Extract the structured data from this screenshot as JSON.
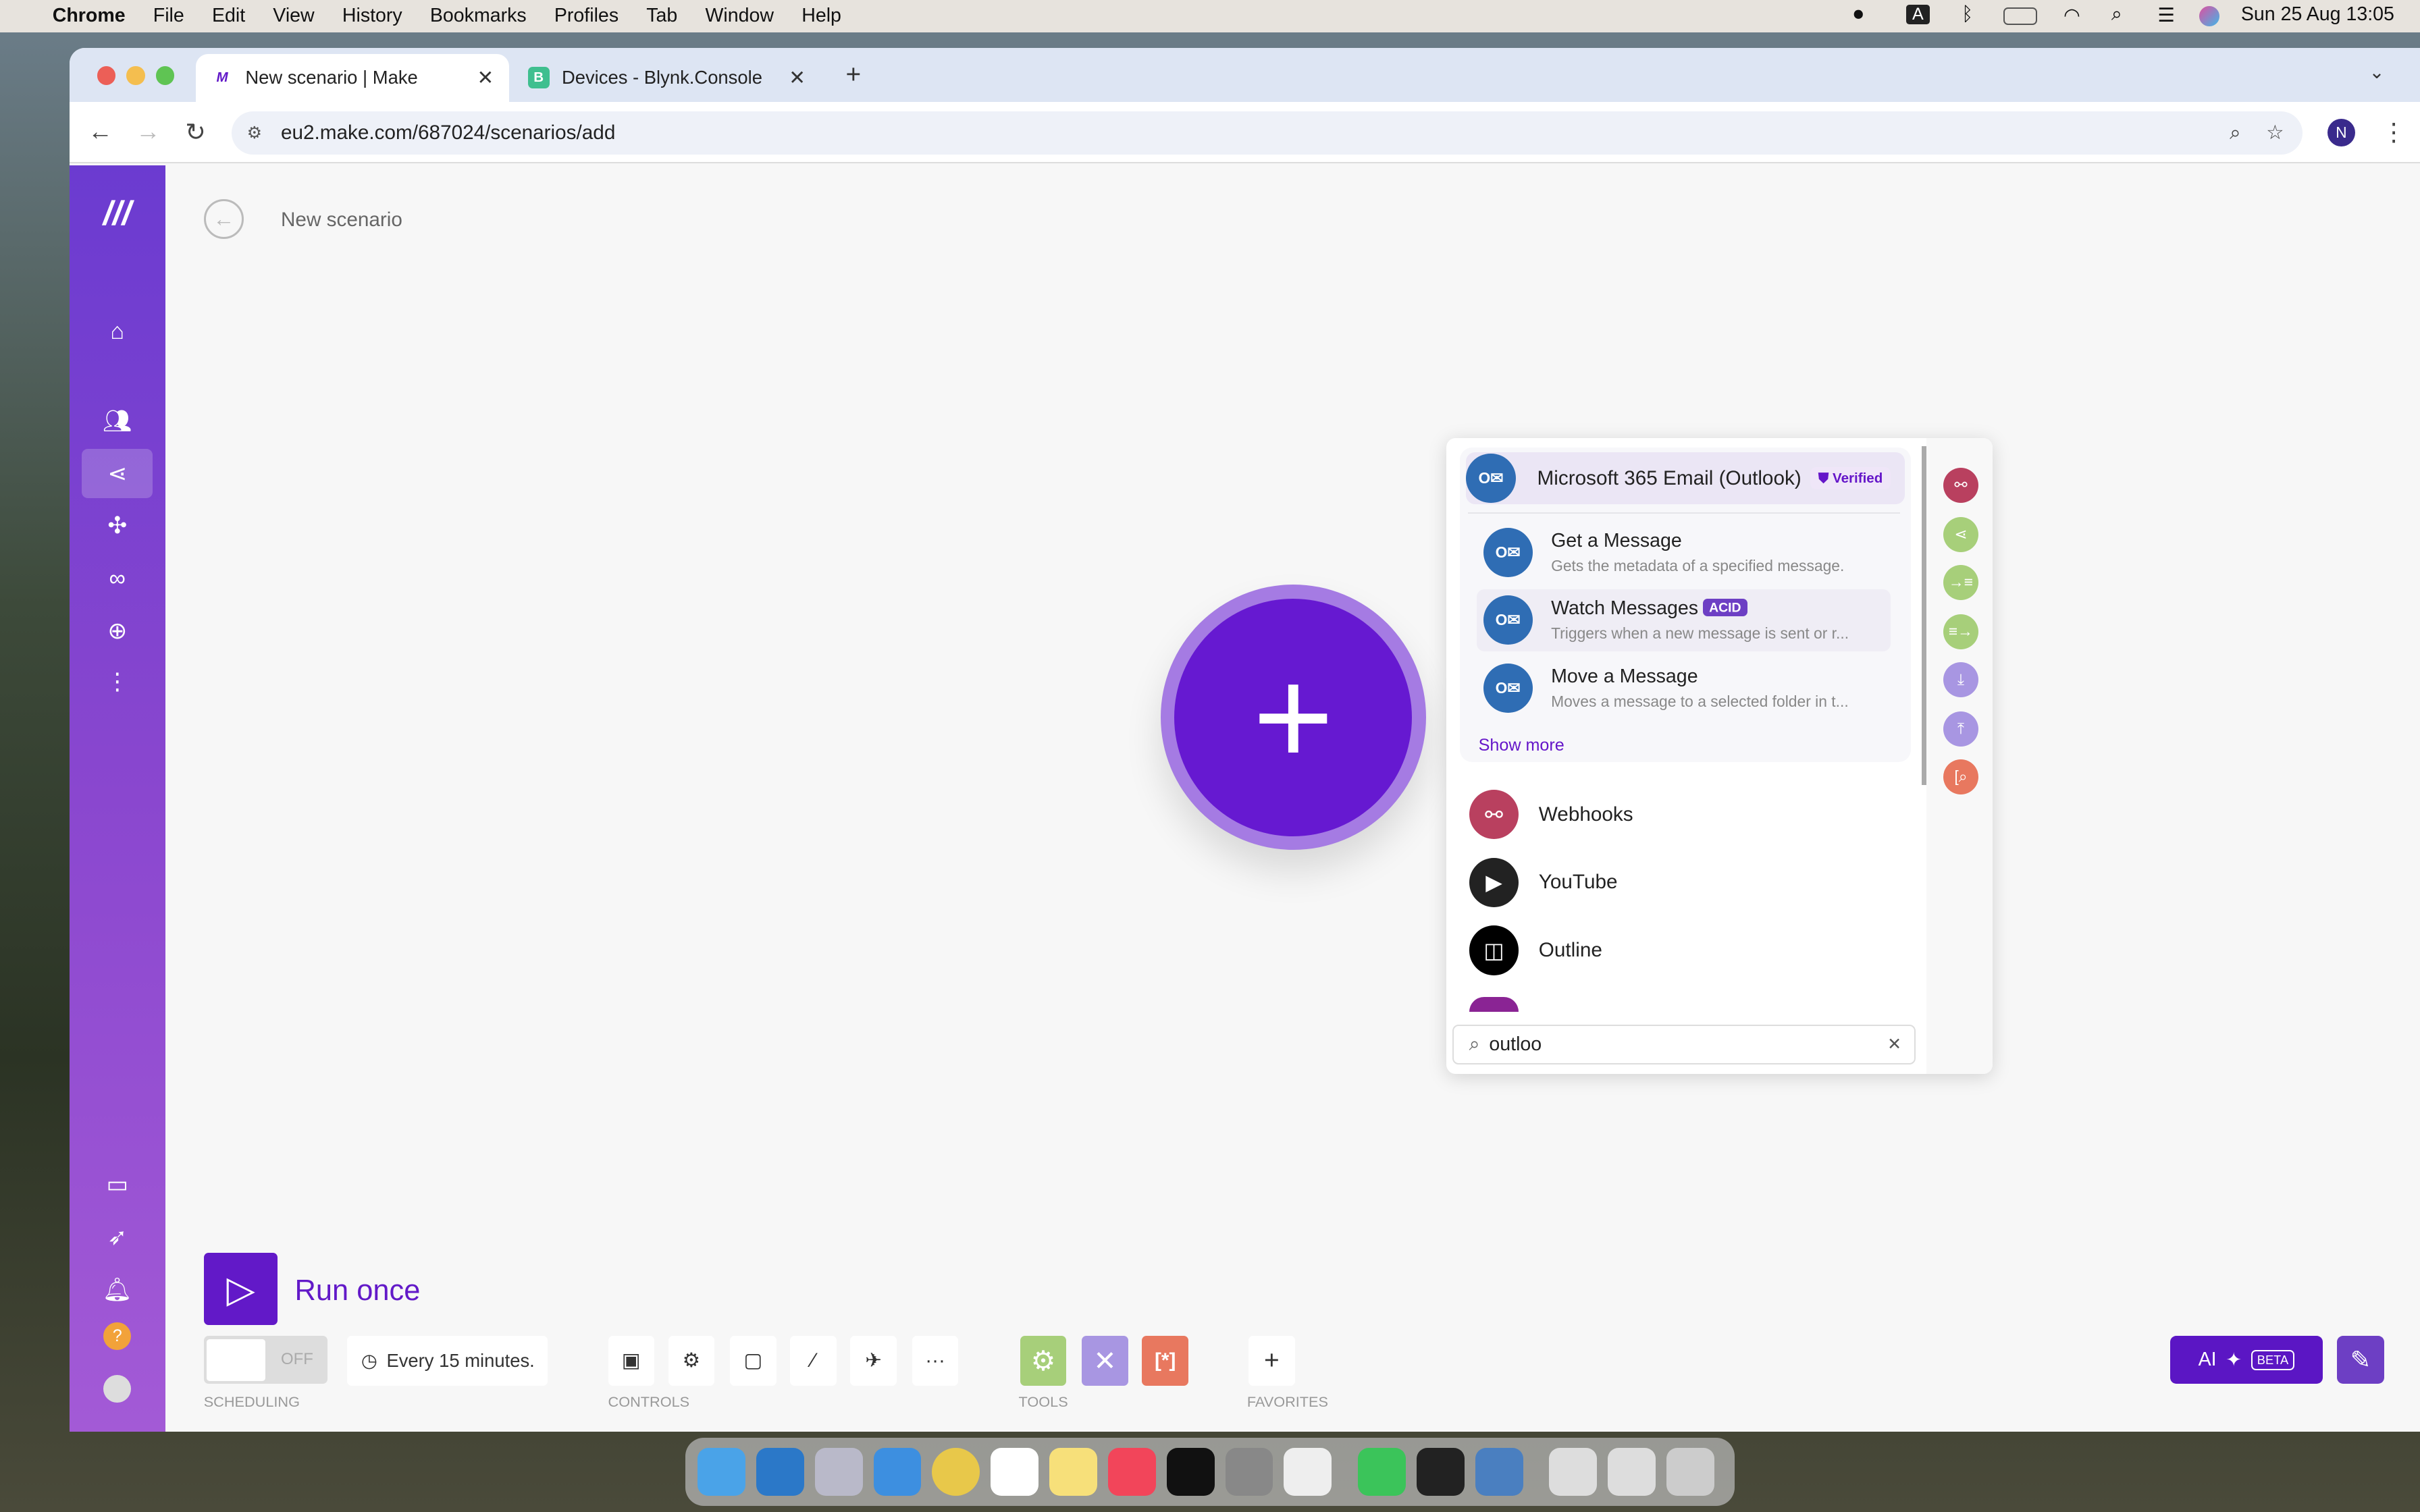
{
  "menubar": {
    "app": "Chrome",
    "items": [
      "File",
      "Edit",
      "View",
      "History",
      "Bookmarks",
      "Profiles",
      "Tab",
      "Window",
      "Help"
    ],
    "datetime": "Sun 25 Aug  13:05",
    "input_source": "A"
  },
  "browser": {
    "tabs": [
      {
        "title": "New scenario | Make",
        "favicon": "M"
      },
      {
        "title": "Devices - Blynk.Console",
        "favicon": "B"
      }
    ],
    "url": "eu2.make.com/687024/scenarios/add",
    "profile": "N"
  },
  "header": {
    "title": "New scenario"
  },
  "panel": {
    "app": {
      "name": "Microsoft 365 Email (Outlook)",
      "badge": "Verified"
    },
    "modules": [
      {
        "title": "Get a Message",
        "desc": "Gets the metadata of a specified message.",
        "badge": ""
      },
      {
        "title": "Watch Messages",
        "desc": "Triggers when a new message is sent or r...",
        "badge": "ACID"
      },
      {
        "title": "Move a Message",
        "desc": "Moves a message to a selected folder in t...",
        "badge": ""
      }
    ],
    "show_more": "Show more",
    "apps": [
      {
        "name": "Webhooks",
        "color": "#b9405f"
      },
      {
        "name": "YouTube",
        "color": "#222222"
      },
      {
        "name": "Outline",
        "color": "#000000"
      }
    ],
    "search": {
      "value": "outloo"
    },
    "quick_icons": [
      {
        "icon": "webhook-icon",
        "color": "#b9405f"
      },
      {
        "icon": "router-icon",
        "color": "#a7cf7a"
      },
      {
        "icon": "iterator-icon",
        "color": "#a7cf7a"
      },
      {
        "icon": "aggregator-icon",
        "color": "#a7cf7a"
      },
      {
        "icon": "import-icon",
        "color": "#a896e2"
      },
      {
        "icon": "export-icon",
        "color": "#a896e2"
      },
      {
        "icon": "search-add-icon",
        "color": "#e8785f"
      }
    ]
  },
  "toolbar": {
    "run_label": "Run once",
    "toggle": "OFF",
    "schedule": "Every 15 minutes.",
    "sections": [
      "SCHEDULING",
      "CONTROLS",
      "TOOLS",
      "FAVORITES"
    ]
  },
  "ai": {
    "label": "AI",
    "badge": "BETA"
  },
  "colors": {
    "accent": "#6219c8",
    "sidebar": "#8a47cf",
    "outlook": "#2f6db4"
  }
}
